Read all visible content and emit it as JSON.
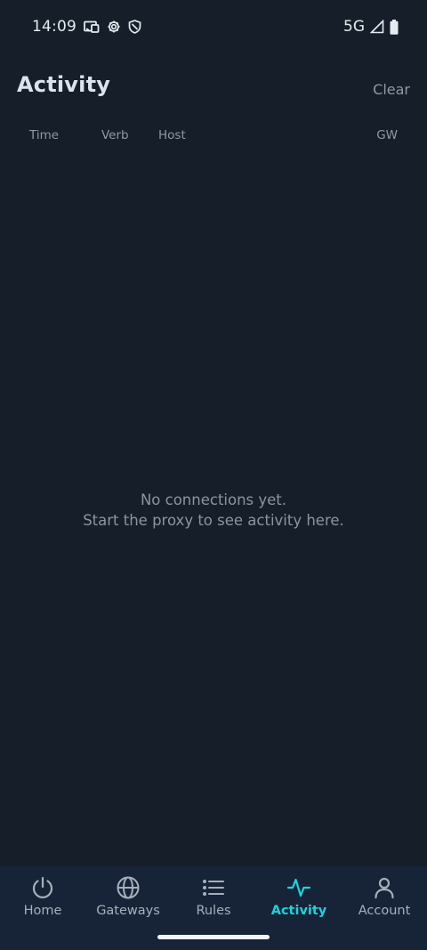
{
  "status_bar": {
    "time": "14:09",
    "network": "5G"
  },
  "header": {
    "title": "Activity",
    "clear_label": "Clear"
  },
  "columns": {
    "time": "Time",
    "verb": "Verb",
    "host": "Host",
    "gw": "GW"
  },
  "empty_state": {
    "line1": "No connections yet.",
    "line2": "Start the proxy to see activity here."
  },
  "nav": {
    "items": [
      {
        "label": "Home",
        "icon": "power-icon"
      },
      {
        "label": "Gateways",
        "icon": "globe-icon"
      },
      {
        "label": "Rules",
        "icon": "list-icon"
      },
      {
        "label": "Activity",
        "icon": "activity-icon",
        "active": true
      },
      {
        "label": "Account",
        "icon": "user-icon"
      }
    ]
  },
  "colors": {
    "background": "#151e29",
    "nav_background": "#172438",
    "accent": "#1dd3dd"
  }
}
